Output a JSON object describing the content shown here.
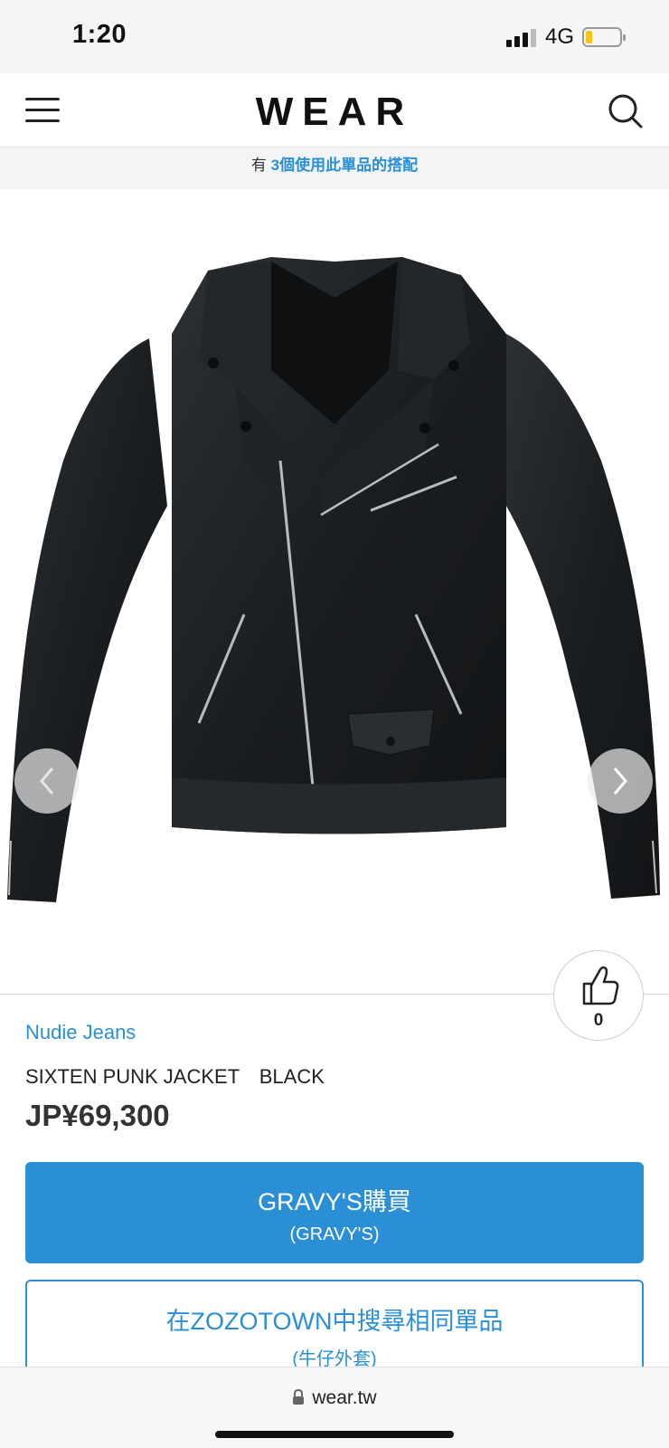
{
  "status_bar": {
    "time": "1:20",
    "network": "4G",
    "battery_level": 0.2,
    "battery_color": "#f5c518"
  },
  "header": {
    "logo": "WEAR",
    "menu_icon": "hamburger-menu-icon",
    "search_icon": "search-icon"
  },
  "banner": {
    "prefix": "有 ",
    "link_text": "3個使用此單品的搭配"
  },
  "product_image": {
    "subject": "black leather biker jacket",
    "prev_icon": "chevron-left-icon",
    "next_icon": "chevron-right-icon"
  },
  "like": {
    "icon": "thumbs-up-icon",
    "count": "0"
  },
  "product": {
    "brand": "Nudie Jeans",
    "name": "SIXTEN PUNK JACKET　BLACK",
    "price": "JP¥69,300"
  },
  "buttons": {
    "buy_label": "GRAVY'S購買",
    "buy_sub": "(GRAVY'S)",
    "zozo_label": "在ZOZOTOWN中搜尋相同單品",
    "zozo_sub": "(牛仔外套)"
  },
  "browser": {
    "url": "wear.tw",
    "lock_icon": "lock-icon"
  },
  "colors": {
    "accent": "#2a8fd4",
    "banner_bg": "#f2f4f6"
  }
}
